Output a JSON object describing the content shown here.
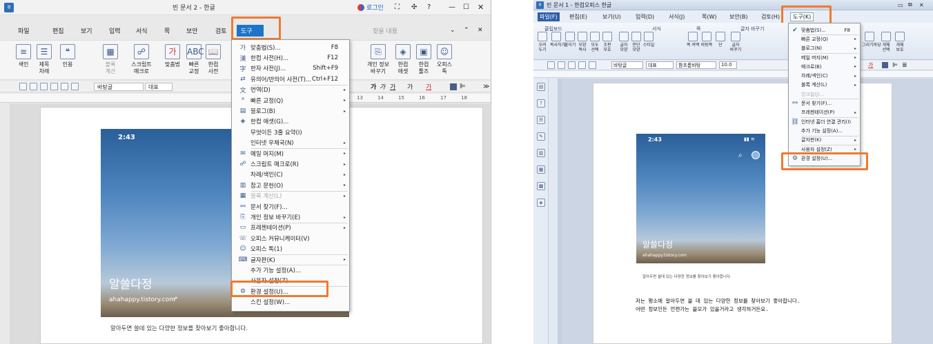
{
  "left": {
    "window_title": "빈 문서 2 - 한글",
    "login": "로그인",
    "menus": [
      "파일",
      "편집",
      "보기",
      "입력",
      "서식",
      "쪽",
      "보안",
      "검토"
    ],
    "active_menu": "도구",
    "search_placeholder": "찾을 내용",
    "ribbon": [
      {
        "icon": "quote-icon",
        "label": "색인"
      },
      {
        "icon": "title-icon",
        "label": "제목\n차례"
      },
      {
        "icon": "cite-icon",
        "label": "인용"
      },
      {
        "icon": "block-icon",
        "label": "블록\n계산"
      },
      {
        "icon": "script-icon",
        "label": "스크립트\n매크로"
      },
      {
        "icon": "spell-icon",
        "label": "맞춤법"
      },
      {
        "icon": "abc-icon",
        "label": "빠른\n교정"
      },
      {
        "icon": "dict-icon",
        "label": "한컴\n사전"
      }
    ],
    "ribbon_right": [
      {
        "label": "개인 정보\n바꾸기"
      },
      {
        "label": "한컴\n애셋"
      },
      {
        "label": "한컴\n툴즈"
      },
      {
        "label": "오피스\n톡"
      }
    ],
    "font_name": "바탕글",
    "style_name": "대표",
    "ruler_numbers": [
      "13",
      "14",
      "15",
      "16",
      "17",
      "18"
    ],
    "menu_items": [
      {
        "icon": "spell-icon",
        "label": "맞춤법(S)...",
        "shortcut": "F8",
        "arrow": ""
      },
      {
        "icon": "dict-icon",
        "label": "한컴 사전(H)...",
        "shortcut": "F12",
        "arrow": ""
      },
      {
        "icon": "hanja-icon",
        "label": "한자 사전(J)...",
        "shortcut": "Shift+F9",
        "arrow": ""
      },
      {
        "icon": "thesaurus-icon",
        "label": "유의어/반의어 사전(T)...",
        "shortcut": "Ctrl+F12",
        "arrow": ""
      },
      {
        "icon": "translate-icon",
        "label": "번역(D)",
        "shortcut": "",
        "arrow": "▸"
      },
      {
        "icon": "abc-icon",
        "label": "빠른 교정(Q)",
        "shortcut": "",
        "arrow": "▸"
      },
      {
        "icon": "blog-icon",
        "label": "블로그(B)",
        "shortcut": "",
        "arrow": "▸"
      },
      {
        "icon": "asset-icon",
        "label": "한컴 애셋(G)...",
        "shortcut": "",
        "arrow": ""
      },
      {
        "icon": "",
        "label": "무엇이든 3줄 요약(I)",
        "shortcut": "",
        "arrow": ""
      },
      {
        "icon": "",
        "label": "인터넷 우체국(N)",
        "shortcut": "",
        "arrow": "▸"
      },
      {
        "icon": "mail-icon",
        "label": "메일 머지(M)",
        "shortcut": "",
        "arrow": "▸"
      },
      {
        "icon": "script-icon",
        "label": "스크립트 매크로(R)",
        "shortcut": "",
        "arrow": "▸"
      },
      {
        "icon": "",
        "label": "차례/색인(C)",
        "shortcut": "",
        "arrow": "▸"
      },
      {
        "icon": "reference-icon",
        "label": "참고 문헌(O)",
        "shortcut": "",
        "arrow": "▸"
      },
      {
        "icon": "block-icon",
        "label": "블록 계산(L)",
        "shortcut": "",
        "arrow": "▸"
      },
      {
        "icon": "binoculars-icon",
        "label": "문서 찾기(F)...",
        "shortcut": "",
        "arrow": ""
      },
      {
        "icon": "privacy-icon",
        "label": "개인 정보 바꾸기(E)",
        "shortcut": "",
        "arrow": "▸"
      },
      {
        "icon": "presentation-icon",
        "label": "프레젠테이션(P)",
        "shortcut": "",
        "arrow": "▸"
      },
      {
        "icon": "community-icon",
        "label": "오피스 커뮤니케이터(V)",
        "shortcut": "",
        "arrow": ""
      },
      {
        "icon": "talk-icon",
        "label": "오피스 톡(1)",
        "shortcut": "",
        "arrow": ""
      },
      {
        "icon": "keyboard-icon",
        "label": "글자판(K)",
        "shortcut": "",
        "arrow": "▸"
      },
      {
        "icon": "",
        "label": "추가 기능 설정(A)...",
        "shortcut": "",
        "arrow": ""
      },
      {
        "icon": "",
        "label": "사용자 설정(Z)",
        "shortcut": "",
        "arrow": ""
      },
      {
        "icon": "gear-icon",
        "label": "환경 설정(U)...",
        "shortcut": "",
        "arrow": ""
      },
      {
        "icon": "",
        "label": "스킨 설정(W)...",
        "shortcut": "",
        "arrow": ""
      }
    ],
    "blog_time": "2:43",
    "blog_title": "알쓸다정",
    "blog_url": "ahahappy.tistory.com",
    "blog_desc": "알아두면 쓸데 있는 다양한 정보를 찾아보기 좋아합니다."
  },
  "right": {
    "window_title": "빈 문서 1 - 한컴오피스 한글",
    "menus": [
      "파일(F)",
      "편집(E)",
      "보기(U)",
      "입력(D)",
      "서식(J)",
      "쪽(W)",
      "보안(B)",
      "검토(H)"
    ],
    "active_menu": "도구(K)",
    "groups": [
      "클립보드",
      "서식",
      "쪽",
      "글자 바꾸기"
    ],
    "ribbon": [
      {
        "label": "오려\n두기"
      },
      {
        "label": "복사하기"
      },
      {
        "label": "붙이기"
      },
      {
        "label": "모양\n복사"
      },
      {
        "label": "모두\n선택"
      },
      {
        "label": "조판\n부호"
      },
      {
        "label": "글자\n모양"
      },
      {
        "label": "문단\n모양"
      },
      {
        "label": "스타일"
      },
      {
        "label": "쪽 여백"
      },
      {
        "label": "바탕쪽"
      },
      {
        "label": "단"
      },
      {
        "label": "글자\n바꾸기"
      }
    ],
    "ribbon_right": [
      {
        "label": "그리기마당"
      },
      {
        "label": "개체\n선택"
      },
      {
        "label": "개체\n보호"
      }
    ],
    "font_name": "바탕글",
    "style_name": "대표",
    "char_style": "함초롬바탕",
    "font_size": "10.0",
    "menu_items": [
      {
        "icon": "check-icon",
        "label": "맞춤법(S)...",
        "shortcut": "F8",
        "arrow": ""
      },
      {
        "icon": "",
        "label": "빠른 교정(Q)",
        "shortcut": "",
        "arrow": "▸"
      },
      {
        "icon": "",
        "label": "블로그(N)",
        "shortcut": "",
        "arrow": "▸"
      },
      {
        "icon": "",
        "label": "메일 머지(M)",
        "shortcut": "",
        "arrow": "▸"
      },
      {
        "icon": "",
        "label": "매크로(B)",
        "shortcut": "",
        "arrow": "▸"
      },
      {
        "icon": "",
        "label": "차례/색인(C)",
        "shortcut": "",
        "arrow": "▸"
      },
      {
        "icon": "",
        "label": "블록 계산(L)",
        "shortcut": "",
        "arrow": "▸"
      },
      {
        "icon": "",
        "label": "잉크일(J)...",
        "shortcut": "",
        "arrow": ""
      },
      {
        "icon": "binoculars-icon",
        "label": "문서 찾기(F)...",
        "shortcut": "",
        "arrow": ""
      },
      {
        "icon": "",
        "label": "프레젠테이션(P)",
        "shortcut": "",
        "arrow": "▸"
      },
      {
        "icon": "link-icon",
        "label": "인터넷 홈더 연결 관리(I)",
        "shortcut": "",
        "arrow": ""
      },
      {
        "icon": "",
        "label": "추가 기능 설정(A)...",
        "shortcut": "",
        "arrow": ""
      },
      {
        "icon": "",
        "label": "글자판(K)",
        "shortcut": "",
        "arrow": "▸"
      },
      {
        "icon": "",
        "label": "사용자 설정(Z)",
        "shortcut": "",
        "arrow": "▸"
      },
      {
        "icon": "gear-icon",
        "label": "환경 설정(U)...",
        "shortcut": "",
        "arrow": ""
      }
    ],
    "blog_time": "2:43",
    "blog_title": "알쓸다정",
    "blog_url": "ahahappy.tistory.com",
    "blog_desc": "알아두면 쓸데 있는 다양한 정보를 찾아보기 좋아합니다.",
    "body_line1": "저는 평소에 알아두면 쓸 데 있는 다양한 정보를 찾아보기 좋아합니다.",
    "body_line2": "어떤 정보인든 언젠가는 쓸모가 있을거라고 생각하거든요."
  },
  "colors": {
    "highlight": "#ee7a2f",
    "active_tab": "#1e74c9"
  }
}
